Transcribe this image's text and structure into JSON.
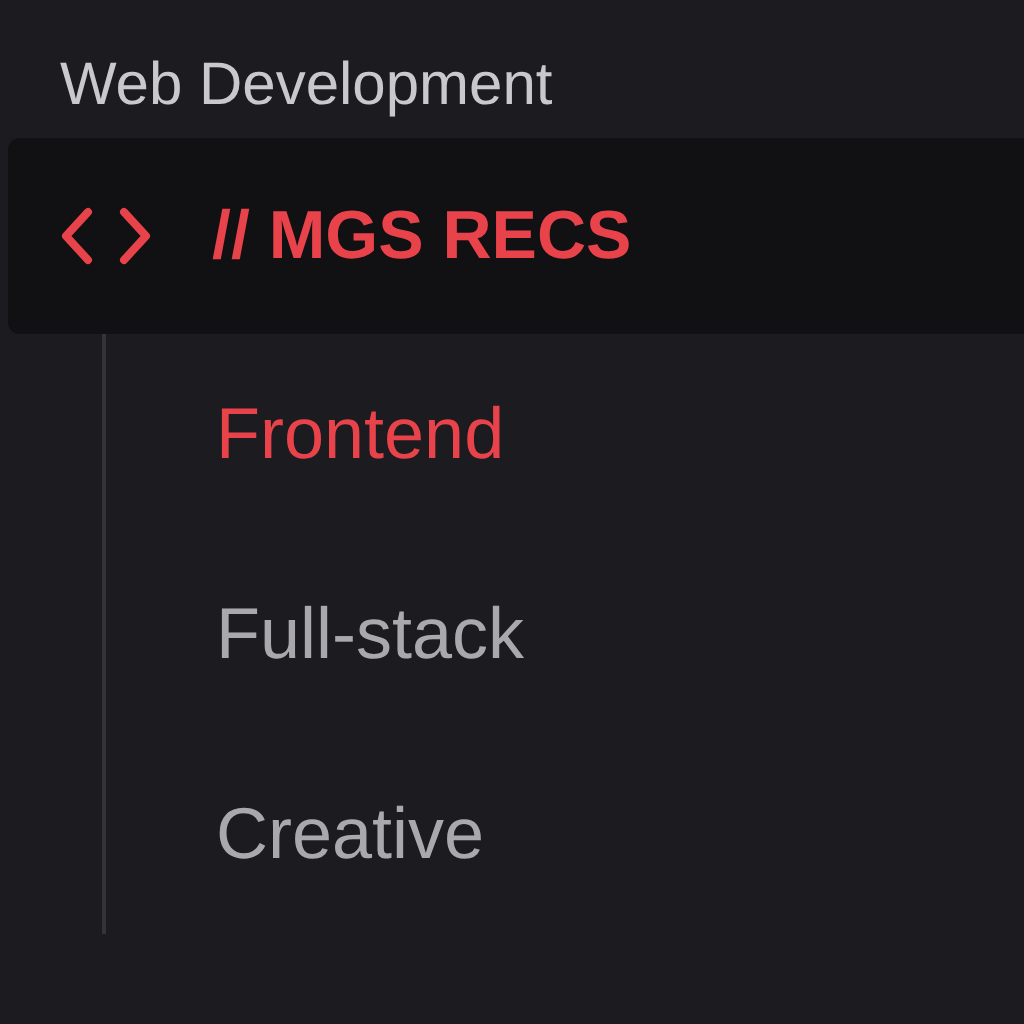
{
  "section_title": "Web Development",
  "group": {
    "label": "// MGS RECS",
    "selected": true,
    "expanded": true,
    "children": [
      {
        "label": "Frontend",
        "selected": true
      },
      {
        "label": "Full-stack",
        "selected": false
      },
      {
        "label": "Creative",
        "selected": false
      }
    ]
  }
}
